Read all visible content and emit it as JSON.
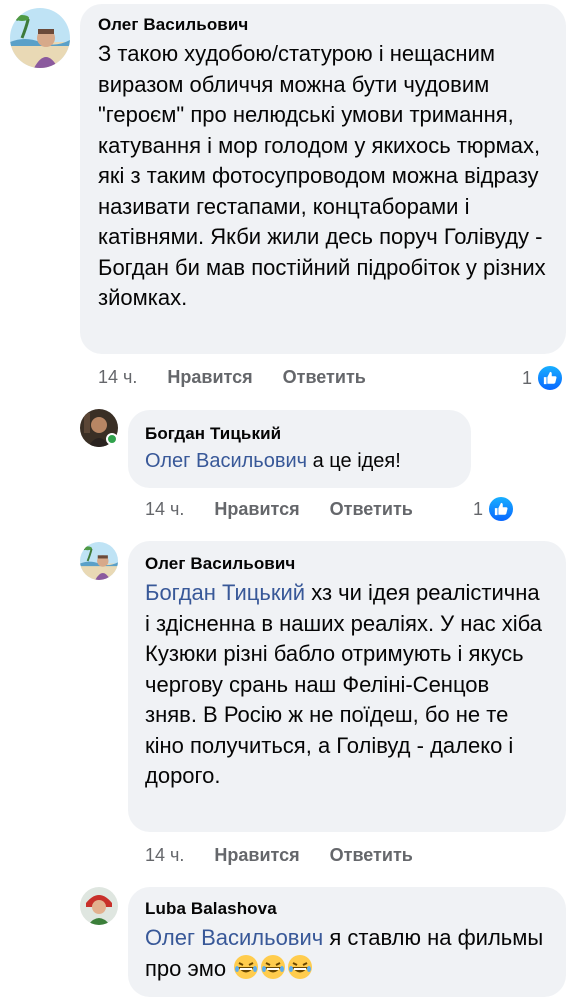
{
  "comments": [
    {
      "author": "Олег Васильович",
      "text": "З такою худобою/статурою і нещасним виразом обличчя можна бути чудовим \"героєм\" про нелюдські умови тримання, катування і мор голодом у якихось тюрмах, які з таким фотосупроводом можна відразу називати гестапами, концтаборами і катівнями. Якби жили десь поруч Голівуду - Богдан би мав постійний підробіток у різних зйомках.",
      "time": "14 ч.",
      "like_label": "Нравится",
      "reply_label": "Ответить",
      "likes": "1"
    },
    {
      "author": "Богдан Тицький",
      "mention": "Олег Васильович",
      "text": " а це ідея!",
      "time": "14 ч.",
      "like_label": "Нравится",
      "reply_label": "Ответить",
      "likes": "1"
    },
    {
      "author": "Олег Васильович",
      "mention": "Богдан Тицький",
      "text": " хз чи ідея реалістична і здісненна в наших реаліях. У нас хіба Кузюки різні бабло отримують і якусь чергову срань наш Феліні-Сенцов зняв. В Росію ж не поїдеш, бо не те кіно получиться, а Голівуд - далеко і дорого.",
      "time": "14 ч.",
      "like_label": "Нравится",
      "reply_label": "Ответить"
    },
    {
      "author": "Luba Balashova",
      "mention": "Олег Васильович",
      "text": " я ставлю на фильмы про эмо",
      "emoji_icons": [
        "laughing-emoji-icon",
        "laughing-emoji-icon",
        "laughing-emoji-icon"
      ]
    }
  ],
  "colors": {
    "bubble": "#f0f2f5",
    "mention": "#385898",
    "meta": "#65676b",
    "like": "#0866ff",
    "online": "#31a24c"
  }
}
